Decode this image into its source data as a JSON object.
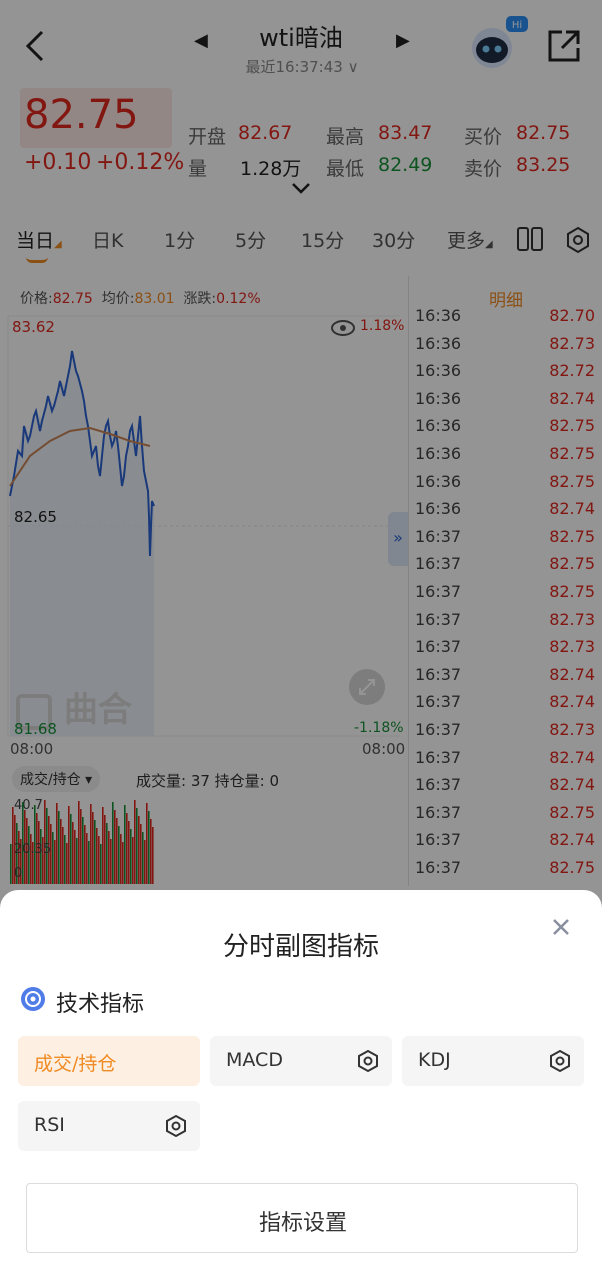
{
  "header": {
    "title": "wti暗油",
    "subtitle": "最近16:37:43 ∨",
    "robot_badge": "Hi",
    "icons": {
      "back": "back-arrow-icon",
      "prev": "caret-left-icon",
      "next": "caret-right-icon",
      "assistant": "robot-assistant-icon",
      "share": "share-icon"
    }
  },
  "quote": {
    "price": "82.75",
    "change": "+0.10",
    "change_pct": "+0.12%",
    "fields": {
      "open_label": "开盘",
      "open_value": "82.67",
      "high_label": "最高",
      "high_value": "83.47",
      "bid_label": "买价",
      "bid_value": "82.75",
      "volume_label": "量",
      "volume_value": "1.28万",
      "low_label": "最低",
      "low_value": "82.49",
      "ask_label": "卖价",
      "ask_value": "83.25"
    },
    "colors": {
      "up": "#e0281f",
      "down": "#17923a"
    }
  },
  "tabs": [
    {
      "label": "当日"
    },
    {
      "label": "日K"
    },
    {
      "label": "1分"
    },
    {
      "label": "5分"
    },
    {
      "label": "15分"
    },
    {
      "label": "30分"
    },
    {
      "label": "更多"
    }
  ],
  "chart": {
    "info_price_label": "价格:",
    "info_price": "82.75",
    "info_avg_label": "均价:",
    "info_avg": "83.01",
    "info_chg_label": "涨跌:",
    "info_chg": "0.12%",
    "y_top": "83.62",
    "y_mid": "82.65",
    "y_bottom": "81.68",
    "pct_top": "1.18%",
    "pct_bottom": "-1.18%",
    "x_start": "08:00",
    "x_end": "08:00",
    "watermark": "曲合",
    "sub_selector": "成交/持仓",
    "sub_info": "成交量: 37 持仓量: 0",
    "vol_top": "40.7",
    "vol_mid": "20.35",
    "vol_bottom": "0"
  },
  "detail": {
    "header": "明细",
    "rows": [
      {
        "time": "16:36",
        "price": "82.70"
      },
      {
        "time": "16:36",
        "price": "82.73"
      },
      {
        "time": "16:36",
        "price": "82.72"
      },
      {
        "time": "16:36",
        "price": "82.74"
      },
      {
        "time": "16:36",
        "price": "82.75"
      },
      {
        "time": "16:36",
        "price": "82.75"
      },
      {
        "time": "16:36",
        "price": "82.75"
      },
      {
        "time": "16:36",
        "price": "82.74"
      },
      {
        "time": "16:37",
        "price": "82.75"
      },
      {
        "time": "16:37",
        "price": "82.75"
      },
      {
        "time": "16:37",
        "price": "82.75"
      },
      {
        "time": "16:37",
        "price": "82.73"
      },
      {
        "time": "16:37",
        "price": "82.73"
      },
      {
        "time": "16:37",
        "price": "82.74"
      },
      {
        "time": "16:37",
        "price": "82.74"
      },
      {
        "time": "16:37",
        "price": "82.73"
      },
      {
        "time": "16:37",
        "price": "82.74"
      },
      {
        "time": "16:37",
        "price": "82.74"
      },
      {
        "time": "16:37",
        "price": "82.75"
      },
      {
        "time": "16:37",
        "price": "82.74"
      },
      {
        "time": "16:37",
        "price": "82.75"
      }
    ]
  },
  "sheet": {
    "title": "分时副图指标",
    "section": "技术指标",
    "options": [
      {
        "label": "成交/持仓",
        "selected": true
      },
      {
        "label": "MACD"
      },
      {
        "label": "KDJ"
      },
      {
        "label": "RSI"
      }
    ],
    "settings_button": "指标设置",
    "accent": "#f08a24"
  }
}
